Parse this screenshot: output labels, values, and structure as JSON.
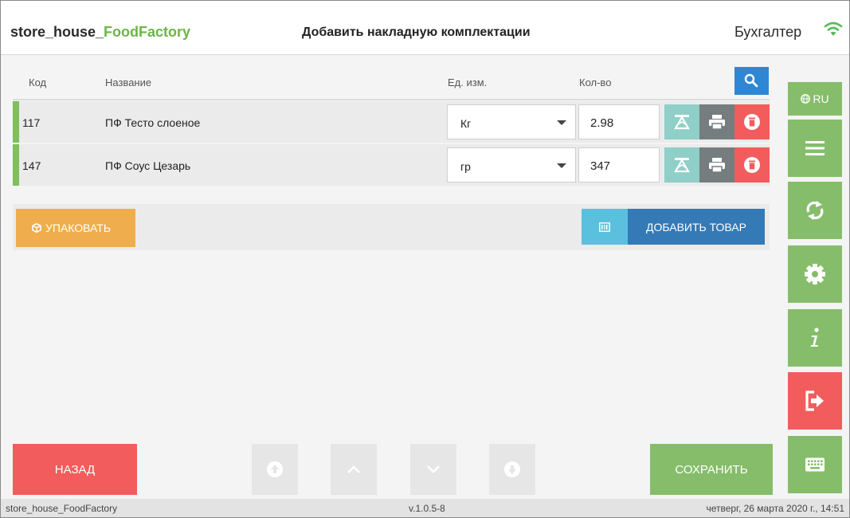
{
  "header": {
    "brand_main": "store_house_",
    "brand_accent": "FoodFactory",
    "title": "Добавить накладную комплектации",
    "user_role": "Бухгалтер"
  },
  "table": {
    "columns": {
      "code": "Код",
      "name": "Название",
      "unit": "Ед. изм.",
      "qty": "Кол-во"
    },
    "rows": [
      {
        "code": "117",
        "name": "ПФ Тесто слоеное",
        "unit": "Кг",
        "qty": "2.98"
      },
      {
        "code": "147",
        "name": "ПФ Соус Цезарь",
        "unit": "гр",
        "qty": "347"
      }
    ]
  },
  "actions": {
    "pack_label": "УПАКОВАТЬ",
    "add_label": "ДОБАВИТЬ ТОВАР"
  },
  "sidebar": {
    "lang_label": "RU"
  },
  "bottom": {
    "back_label": "НАЗАД",
    "save_label": "СОХРАНИТЬ"
  },
  "footer": {
    "app": "store_house_FoodFactory",
    "version": "v.1.0.5-8",
    "datetime": "четверг, 26 марта 2020 г., 14:51"
  },
  "colors": {
    "accent_green": "#86bd6b",
    "danger_red": "#f25c5c",
    "primary_blue": "#337ab7",
    "warning_orange": "#f0ad4e",
    "info_cyan": "#5bc0de"
  },
  "icons": {
    "search": "search-icon",
    "wifi": "wifi-icon",
    "scale": "scale-icon",
    "print": "print-icon",
    "delete": "trash-icon",
    "box": "box-icon",
    "barcode": "barcode-icon",
    "globe": "globe-icon",
    "menu": "menu-icon",
    "sync": "sync-icon",
    "settings": "gear-icon",
    "info": "info-icon",
    "exit": "exit-icon",
    "keyboard": "keyboard-icon"
  }
}
